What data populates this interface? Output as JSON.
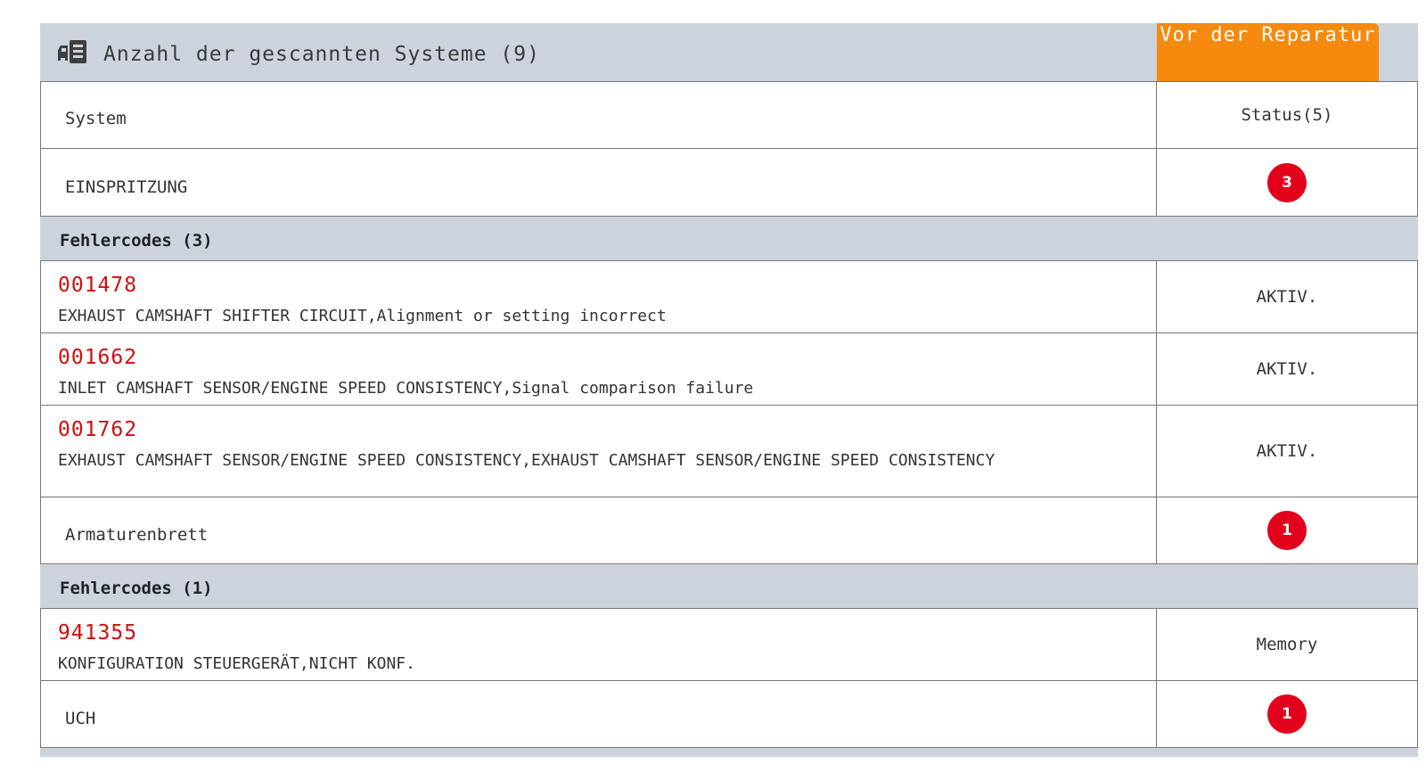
{
  "header": {
    "title": "Anzahl der gescannten Systeme (9)",
    "phase": "Vor der Reparatur",
    "icon": "document-scan-icon",
    "phase_color": "#f58a0e"
  },
  "columns": {
    "system": "System",
    "status": "Status(5)"
  },
  "systems": [
    {
      "name": "EINSPRITZUNG",
      "count": "3",
      "codes_label": "Fehlercodes (3)",
      "codes": [
        {
          "code": "001478",
          "description": "EXHAUST CAMSHAFT SHIFTER CIRCUIT,Alignment or setting incorrect",
          "status": "AKTIV."
        },
        {
          "code": "001662",
          "description": "INLET CAMSHAFT SENSOR/ENGINE SPEED CONSISTENCY,Signal comparison failure",
          "status": "AKTIV."
        },
        {
          "code": "001762",
          "description": "EXHAUST CAMSHAFT SENSOR/ENGINE SPEED CONSISTENCY,EXHAUST CAMSHAFT SENSOR/ENGINE SPEED CONSISTENCY",
          "status": "AKTIV."
        }
      ]
    },
    {
      "name": "Armaturenbrett",
      "count": "1",
      "codes_label": "Fehlercodes (1)",
      "codes": [
        {
          "code": "941355",
          "description": "KONFIGURATION STEUERGERÄT,NICHT KONF.",
          "status": "Memory"
        }
      ]
    },
    {
      "name": "UCH",
      "count": "1"
    }
  ],
  "colors": {
    "code_red": "#d20d0d",
    "badge_red": "#e3001b",
    "band_gray": "#ccd3dd"
  }
}
